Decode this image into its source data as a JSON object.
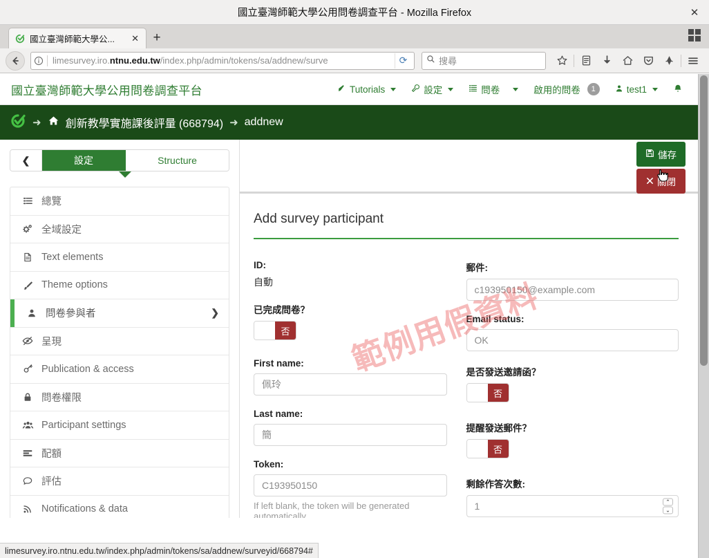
{
  "browser": {
    "window_title": "國立臺灣師範大學公用問卷調查平台 - Mozilla Firefox",
    "window_close_label": "✕",
    "tab": {
      "title": "國立臺灣師範大學公...",
      "close_label": "✕"
    },
    "new_tab_label": "+",
    "url_prefix": "limesurvey.iro.",
    "url_domain": "ntnu.edu.tw",
    "url_suffix": "/index.php/admin/tokens/sa/addnew/surve",
    "reload_label": "⟳",
    "search_placeholder": "搜尋",
    "status_link": "limesurvey.iro.ntnu.edu.tw/index.php/admin/tokens/sa/addnew/surveyid/668794#"
  },
  "app": {
    "brand": "國立臺灣師範大學公用問卷調查平台",
    "nav": [
      {
        "label": "Tutorials",
        "icon": "rocket-icon",
        "caret": true,
        "badge": null
      },
      {
        "label": "設定",
        "icon": "wrench-icon",
        "caret": true,
        "badge": null
      },
      {
        "label": "問卷",
        "icon": "list-icon",
        "caret": true,
        "badge": null
      },
      {
        "label": "啟用的問卷",
        "icon": null,
        "caret": false,
        "badge": "1"
      },
      {
        "label": "test1",
        "icon": "user-icon",
        "caret": true,
        "badge": null
      },
      {
        "label": "",
        "icon": "bell-icon",
        "caret": false,
        "badge": null
      }
    ],
    "breadcrumb": {
      "logo": "limesurvey-logo-icon",
      "arrow": "➜",
      "home_icon": "home-icon",
      "survey": "創新教學實施課後評量 (668794)",
      "current": "addnew"
    }
  },
  "sidebar": {
    "collapse_label": "❮",
    "tabs": [
      {
        "label": "設定",
        "active": true
      },
      {
        "label": "Structure",
        "active": false
      }
    ],
    "items": [
      {
        "label": "總覽",
        "icon": "list-ul-icon",
        "active": false,
        "chevron": false
      },
      {
        "label": "全域設定",
        "icon": "cogs-icon",
        "active": false,
        "chevron": false
      },
      {
        "label": "Text elements",
        "icon": "file-text-icon",
        "active": false,
        "chevron": false
      },
      {
        "label": "Theme options",
        "icon": "brush-icon",
        "active": false,
        "chevron": false
      },
      {
        "label": "問卷參與者",
        "icon": "user-icon",
        "active": true,
        "chevron": true
      },
      {
        "label": "呈現",
        "icon": "eye-slash-icon",
        "active": false,
        "chevron": false
      },
      {
        "label": "Publication & access",
        "icon": "key-icon",
        "active": false,
        "chevron": false
      },
      {
        "label": "問卷權限",
        "icon": "lock-icon",
        "active": false,
        "chevron": false
      },
      {
        "label": "Participant settings",
        "icon": "users-icon",
        "active": false,
        "chevron": false
      },
      {
        "label": "配額",
        "icon": "sliders-icon",
        "active": false,
        "chevron": false
      },
      {
        "label": "評估",
        "icon": "comment-icon",
        "active": false,
        "chevron": false
      },
      {
        "label": "Notifications & data",
        "icon": "rss-icon",
        "active": false,
        "chevron": false
      }
    ]
  },
  "toolbar": {
    "save_label": "儲存",
    "save_icon": "floppy-disk-icon",
    "close_label": "關閉",
    "close_icon": "times-icon"
  },
  "form": {
    "title": "Add survey participant",
    "watermark": "範例用假資料",
    "left": {
      "id_label": "ID:",
      "id_value": "自動",
      "completed_label": "已完成問卷？",
      "completed_toggle": "否",
      "first_name_label": "First name:",
      "first_name_value": "佩玲",
      "last_name_label": "Last name:",
      "last_name_value": "簡",
      "token_label": "Token:",
      "token_value": "C193950150",
      "token_help": "If left blank, the token will be generated automatically"
    },
    "right": {
      "email_label": "郵件:",
      "email_value": "c193950150@example.com",
      "email_status_label": "Email status:",
      "email_status_value": "OK",
      "invitation_label": "是否發送邀請函？",
      "invitation_toggle": "否",
      "reminder_label": "提醒發送郵件？",
      "reminder_toggle": "否",
      "uses_left_label": "剩餘作答次數:",
      "uses_left_value": "1",
      "spinner_up": "⌃",
      "spinner_down": "⌄"
    }
  },
  "colors": {
    "brand_green": "#2f7d32",
    "dark_green": "#1a4a18",
    "save_green": "#1e6b27",
    "danger_red": "#a03030",
    "accent_green": "#4caf50",
    "watermark": "#e95a5a"
  }
}
